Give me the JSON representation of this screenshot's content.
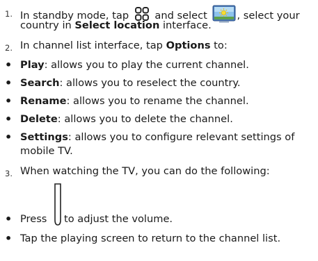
{
  "steps": [
    {
      "number": "1.",
      "before_apps_icon": "In standby mode, tap",
      "apps_icon": "apps-grid-icon",
      "between_icons": "and select",
      "tv_icon": "mobile-tv-icon",
      "after_tv_icon": ", select your",
      "line2_before": "country in",
      "line2_bold": "Select location",
      "line2_after": "interface."
    },
    {
      "number": "2.",
      "before": "In channel list interface, tap",
      "bold": "Options",
      "after": "to:"
    },
    {
      "number": "3.",
      "text": "When watching the TV, you can do the following:"
    }
  ],
  "options": [
    {
      "term": "Play",
      "desc": ": allows you to play the current channel."
    },
    {
      "term": "Search",
      "desc": ": allows you to reselect the country."
    },
    {
      "term": "Rename",
      "desc": ": allows you to rename the channel."
    },
    {
      "term": "Delete",
      "desc": ": allows you to delete the channel."
    },
    {
      "term": "Settings",
      "desc": ": allows you to configure relevant settings of",
      "desc_line2": "mobile TV."
    }
  ],
  "watching": [
    {
      "before": "Press",
      "icon": "volume-key-icon",
      "after": "to adjust the volume."
    },
    {
      "text": "Tap the playing screen to return to the channel list."
    }
  ],
  "bullet": "•"
}
